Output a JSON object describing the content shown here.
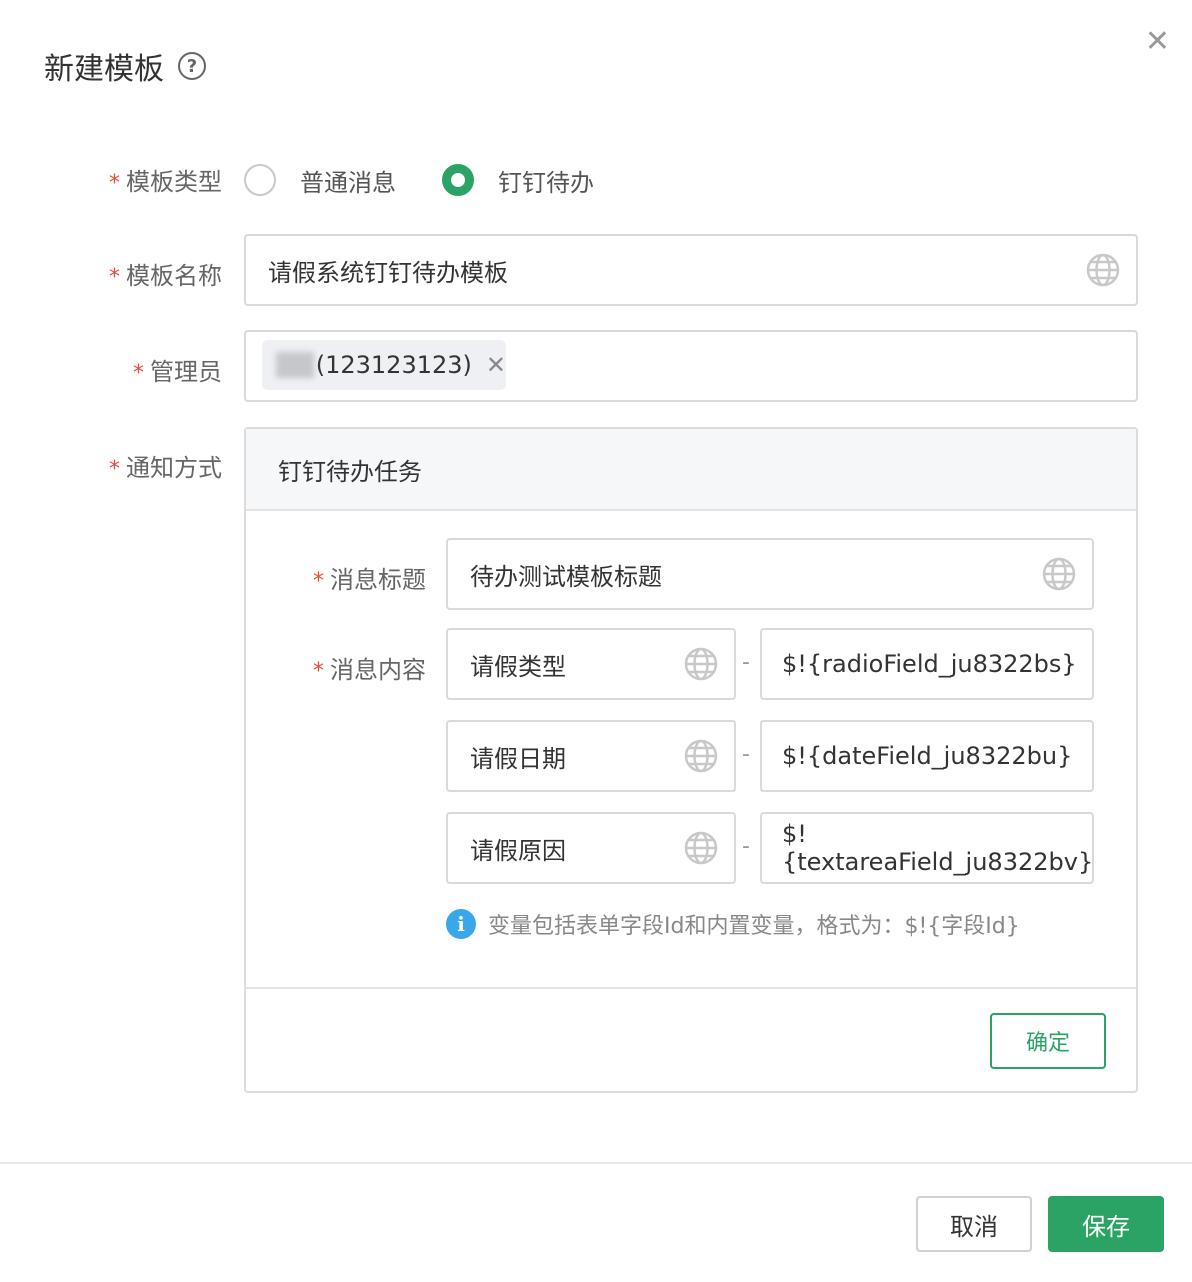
{
  "dialog": {
    "title": "新建模板",
    "help_icon": "?",
    "close_icon": "✕"
  },
  "form": {
    "template_type": {
      "label": "模板类型",
      "options": [
        "普通消息",
        "钉钉待办"
      ],
      "selected": "钉钉待办"
    },
    "template_name": {
      "label": "模板名称",
      "value": "请假系统钉钉待办模板"
    },
    "admin": {
      "label": "管理员",
      "tag_text": "(123123123)",
      "tag_remove": "✕"
    },
    "notify_method": {
      "label": "通知方式",
      "panel_title": "钉钉待办任务",
      "message_title": {
        "label": "消息标题",
        "value": "待办测试模板标题"
      },
      "message_content": {
        "label": "消息内容",
        "separator": "-",
        "rows": [
          {
            "key": "请假类型",
            "value": "$!{radioField_ju8322bs}"
          },
          {
            "key": "请假日期",
            "value": "$!{dateField_ju8322bu}"
          },
          {
            "key": "请假原因",
            "value": "$!{textareaField_ju8322bv}"
          }
        ]
      },
      "hint_icon": "i",
      "hint": "变量包括表单字段Id和内置变量，格式为：$!{字段Id}",
      "confirm_label": "确定"
    }
  },
  "footer": {
    "cancel_label": "取消",
    "save_label": "保存"
  },
  "colors": {
    "accent": "#2aa365",
    "required": "#e74c3c",
    "info": "#3aa8e8"
  }
}
